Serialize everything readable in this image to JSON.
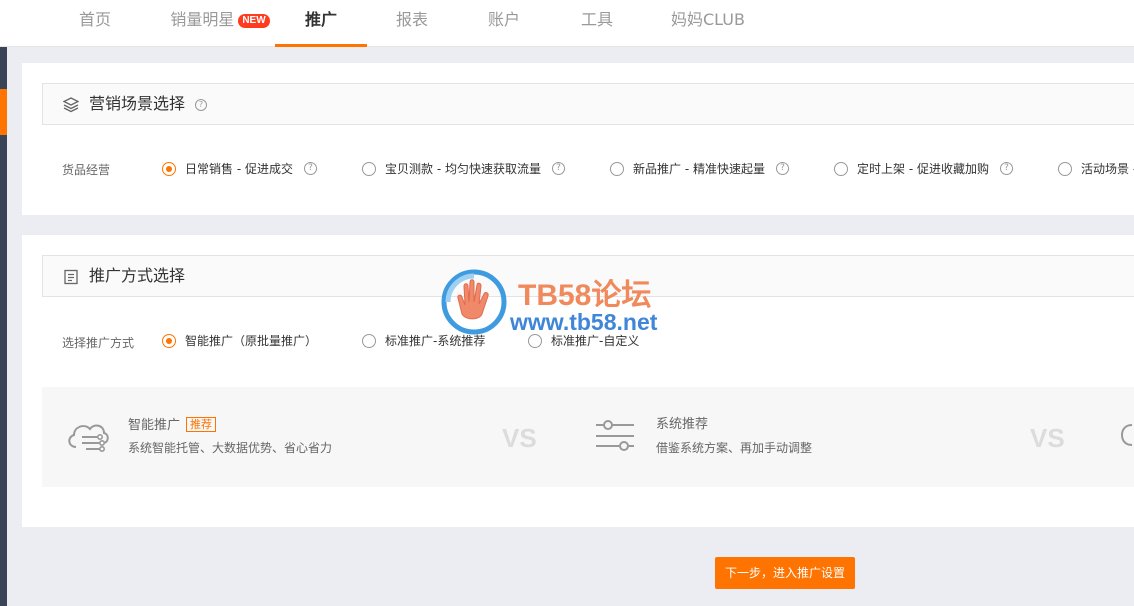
{
  "nav": {
    "tabs": [
      {
        "label": "首页"
      },
      {
        "label": "销量明星",
        "badge": "NEW"
      },
      {
        "label": "推广",
        "active": true
      },
      {
        "label": "报表"
      },
      {
        "label": "账户"
      },
      {
        "label": "工具"
      },
      {
        "label": "妈妈CLUB"
      }
    ]
  },
  "scene": {
    "title": "营销场景选择",
    "help": "?",
    "row_label": "货品经营",
    "options": [
      {
        "label": "日常销售 - 促进成交",
        "checked": true
      },
      {
        "label": "宝贝测款 - 均匀快速获取流量"
      },
      {
        "label": "新品推广 - 精准快速起量"
      },
      {
        "label": "定时上架 - 促进收藏加购"
      },
      {
        "label": "活动场景 -"
      }
    ]
  },
  "method": {
    "title": "推广方式选择",
    "row_label": "选择推广方式",
    "options": [
      {
        "label": "智能推广（原批量推广）",
        "checked": true
      },
      {
        "label": "标准推广-系统推荐"
      },
      {
        "label": "标准推广-自定义"
      }
    ],
    "compare": {
      "items": [
        {
          "title": "智能推广",
          "tag": "推荐",
          "desc": "系统智能托管、大数据优势、省心省力"
        },
        {
          "title": "系统推荐",
          "desc": "借鉴系统方案、再加手动调整"
        }
      ],
      "vs": "VS"
    }
  },
  "watermark": {
    "line1": "TB58论坛",
    "line2": "www.tb58.net"
  },
  "next_button": "下一步，进入推广设置",
  "colors": {
    "accent": "#ff7300",
    "rail": "#394457",
    "badge": "#ff3b1f"
  }
}
